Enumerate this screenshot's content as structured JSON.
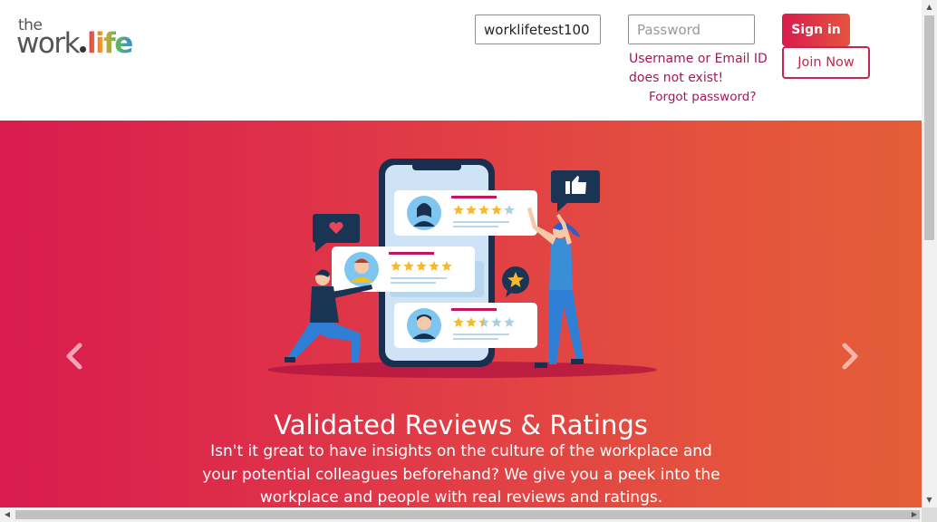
{
  "logo": {
    "the": "the",
    "work": "work",
    "life": "life"
  },
  "login": {
    "username_value": "worklifetest100",
    "password_placeholder": "Password",
    "error_text": "Username or Email ID does not exist!",
    "forgot_label": "Forgot password?",
    "signin_label": "Sign in",
    "join_label": "Join Now"
  },
  "hero": {
    "title": "Validated Reviews & Ratings",
    "description": "Isn't it great to have insights on the culture of the workplace and your potential colleagues beforehand? We give you a peek into the workplace and people with real reviews and ratings.",
    "prev_icon": "chevron-left-icon",
    "next_icon": "chevron-right-icon",
    "review_ratings": [
      4,
      5,
      2.5
    ]
  },
  "colors": {
    "accent": "#a3185a",
    "brand_gradient_start": "#d91b4e",
    "brand_gradient_end": "#e35e39",
    "star": "#f5b82e"
  }
}
